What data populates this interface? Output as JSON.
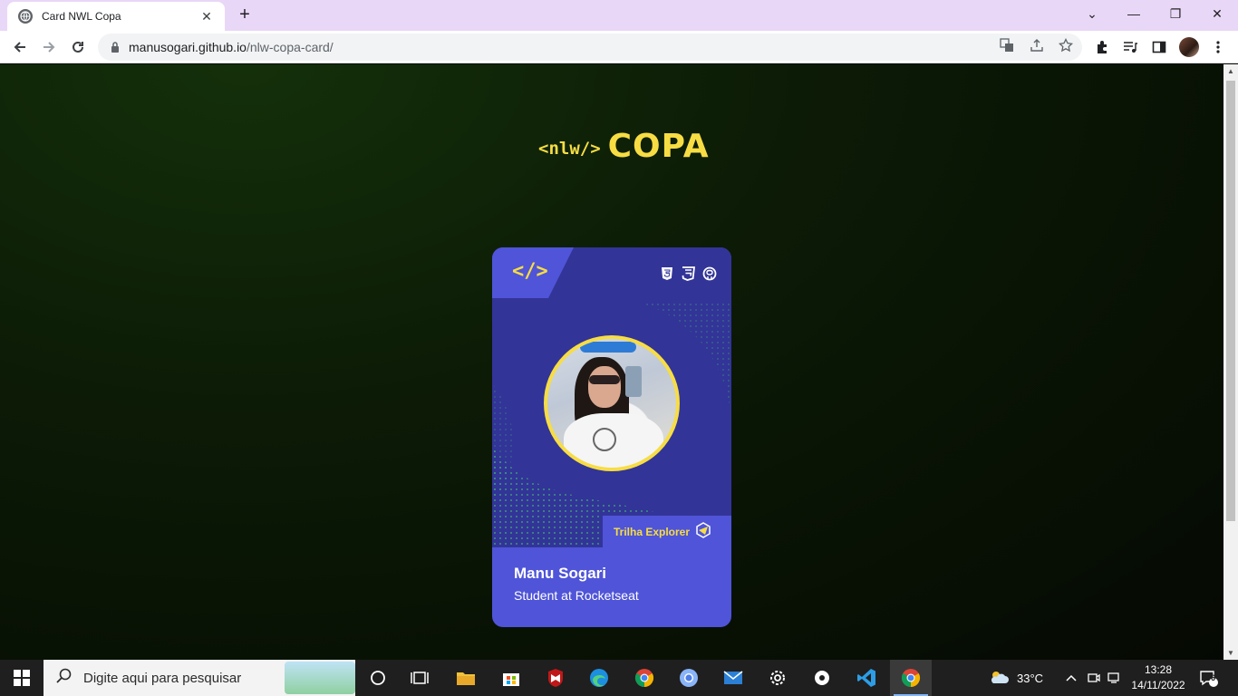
{
  "browser": {
    "tab_title": "Card NWL Copa",
    "tab_close": "✕",
    "new_tab": "+",
    "url_host": "manusogari.github.io",
    "url_path": "/nlw-copa-card/",
    "window_controls": {
      "dropdown": "⌄",
      "minimize": "—",
      "restore": "❐",
      "close": "✕"
    }
  },
  "page": {
    "logo_tag": "<nlw/>",
    "logo_word": "COPA",
    "card": {
      "code_tag": "</>",
      "tech_icons": [
        "html5-icon",
        "css3-icon",
        "github-icon"
      ],
      "trail_label": "Trilha Explorer",
      "name": "Manu Sogari",
      "role": "Student at Rocketseat"
    }
  },
  "taskbar": {
    "search_placeholder": "Digite aqui para pesquisar",
    "temperature": "33°C",
    "time": "13:28",
    "date": "14/11/2022",
    "notifications": "6"
  },
  "colors": {
    "accent_yellow": "#f7dd43",
    "card_blue": "#4f54d8",
    "card_dark": "#323498",
    "tabstrip": "#e9d7f7"
  }
}
